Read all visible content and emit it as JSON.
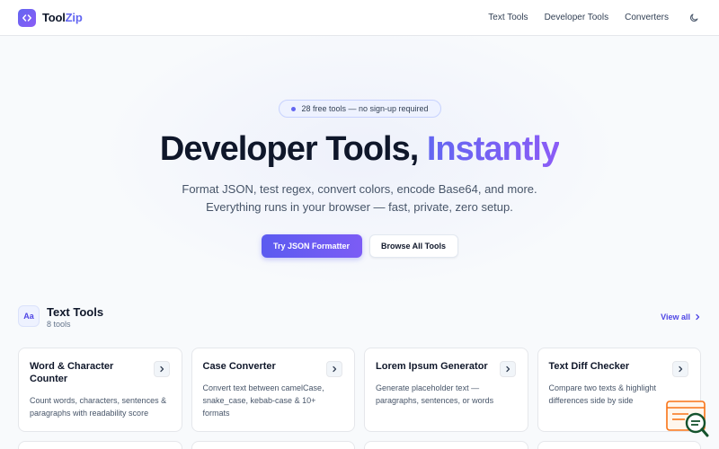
{
  "nav": {
    "brand_a": "Tool",
    "brand_b": "Zip",
    "links": [
      "Text Tools",
      "Developer Tools",
      "Converters"
    ],
    "theme_icon": "moon-icon"
  },
  "hero": {
    "pill": "28 free tools — no sign-up required",
    "title_plain": "Developer Tools, ",
    "title_accent": "Instantly",
    "sub_line1": "Format JSON, test regex, convert colors, encode Base64, and more.",
    "sub_line2": "Everything runs in your browser — fast, private, zero setup.",
    "cta_primary": "Try JSON Formatter",
    "cta_secondary": "Browse All Tools"
  },
  "section": {
    "icon_text": "Aa",
    "title": "Text Tools",
    "count": "8 tools",
    "view_all": "View all"
  },
  "cards": [
    {
      "title": "Word & Character Counter",
      "desc": "Count words, characters, sentences & paragraphs with readability score"
    },
    {
      "title": "Case Converter",
      "desc": "Convert text between camelCase, snake_case, kebab-case & 10+ formats"
    },
    {
      "title": "Lorem Ipsum Generator",
      "desc": "Generate placeholder text — paragraphs, sentences, or words"
    },
    {
      "title": "Text Diff Checker",
      "desc": "Compare two texts & highlight differences side by side"
    }
  ],
  "colors": {
    "accent": "#6366f1",
    "accent2": "#8b5cf6",
    "text": "#0f172a",
    "muted": "#475569"
  }
}
